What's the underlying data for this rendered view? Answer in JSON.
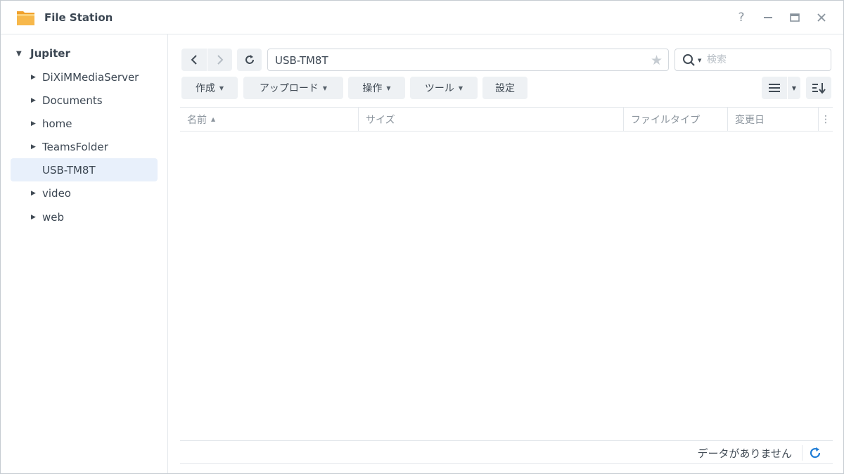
{
  "window": {
    "title": "File Station",
    "help_glyph": "?",
    "minimize_glyph": "—",
    "maximize_glyph": "▭",
    "close_glyph": "✕"
  },
  "sidebar": {
    "root": {
      "label": "Jupiter",
      "expanded": true
    },
    "items": [
      {
        "label": "DiXiMMediaServer",
        "has_children": true,
        "selected": false
      },
      {
        "label": "Documents",
        "has_children": true,
        "selected": false
      },
      {
        "label": "home",
        "has_children": true,
        "selected": false
      },
      {
        "label": "TeamsFolder",
        "has_children": true,
        "selected": false
      },
      {
        "label": "USB-TM8T",
        "has_children": false,
        "selected": true
      },
      {
        "label": "video",
        "has_children": true,
        "selected": false
      },
      {
        "label": "web",
        "has_children": true,
        "selected": false
      }
    ]
  },
  "toolbar": {
    "path": "USB-TM8T",
    "search_placeholder": "検索",
    "create_label": "作成",
    "upload_label": "アップロード",
    "action_label": "操作",
    "tools_label": "ツール",
    "settings_label": "設定"
  },
  "grid": {
    "columns": [
      "名前",
      "サイズ",
      "ファイルタイプ",
      "変更日"
    ],
    "sort_column": "名前",
    "rows": []
  },
  "status": {
    "text": "データがありません"
  },
  "colors": {
    "accent": "#1e7cd6",
    "selected_bg": "#e8f0fb",
    "button_bg": "#eef1f4",
    "folder_icon": "#f5a623"
  },
  "icons": [
    "folder-app-icon",
    "help-icon",
    "minimize-icon",
    "maximize-icon",
    "close-icon",
    "chevron-left-icon",
    "chevron-right-icon",
    "refresh-icon",
    "star-icon",
    "search-icon",
    "list-view-icon",
    "sort-icon"
  ]
}
